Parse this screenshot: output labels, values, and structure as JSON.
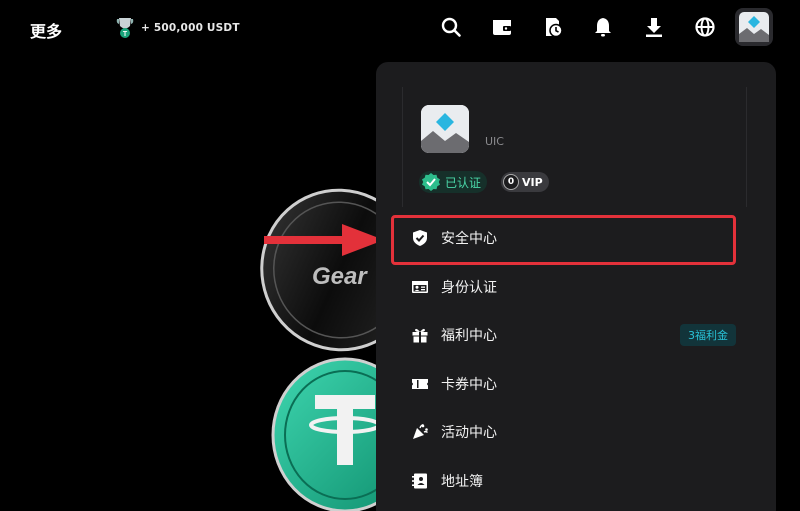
{
  "topbar": {
    "more_label": "更多",
    "promo_text": "+ 500,000 USDT",
    "icons": [
      "search-icon",
      "wallet-icon",
      "orders-history-icon",
      "bell-icon",
      "download-icon",
      "globe-icon",
      "avatar"
    ]
  },
  "background": {
    "coin_text": "Gear"
  },
  "dropdown": {
    "profile": {
      "uid_label": "UIC",
      "verified_label": "已认证",
      "vip_level": "0",
      "vip_label": "VIP"
    },
    "menu": [
      {
        "label": "安全中心",
        "icon": "shield-check-icon",
        "highlighted": true
      },
      {
        "label": "身份认证",
        "icon": "id-card-icon"
      },
      {
        "label": "福利中心",
        "icon": "gift-icon",
        "badge": "3福利金"
      },
      {
        "label": "卡券中心",
        "icon": "ticket-icon"
      },
      {
        "label": "活动中心",
        "icon": "party-popper-icon"
      },
      {
        "label": "地址簿",
        "icon": "address-book-icon"
      }
    ]
  },
  "colors": {
    "background": "#000000",
    "panel": "#1c1c1e",
    "highlight_border": "#e3313a",
    "verified_green": "#4ad7a8",
    "badge_cyan": "#29c2d6"
  }
}
